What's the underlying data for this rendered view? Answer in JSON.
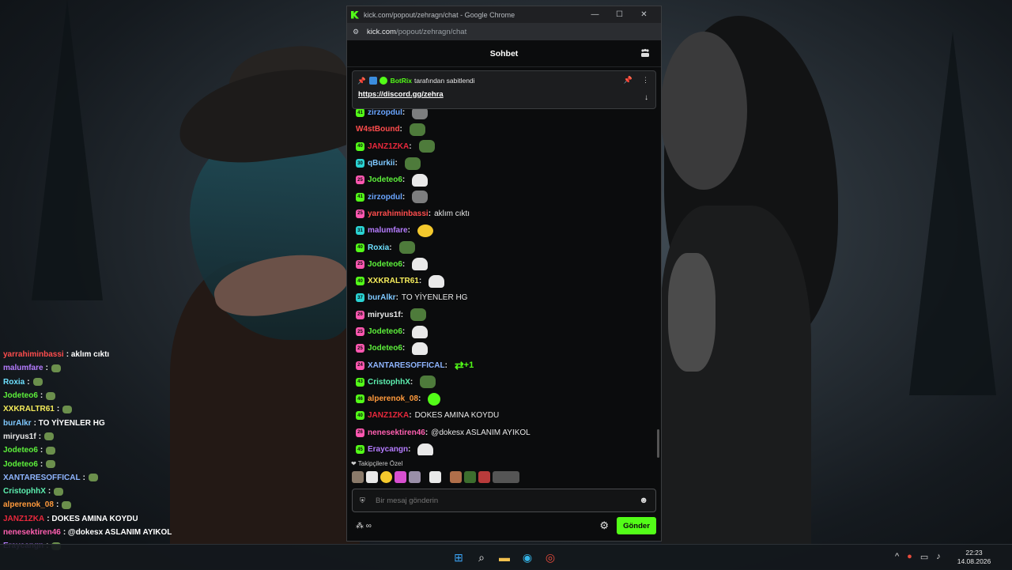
{
  "window": {
    "title": "kick.com/popout/zehragn/chat - Google Chrome",
    "url_domain": "kick.com",
    "url_path": "/popout/zehragn/chat",
    "controls": {
      "minimize": "—",
      "maximize": "☐",
      "close": "✕"
    }
  },
  "chat_header": {
    "title": "Sohbet"
  },
  "pinned": {
    "bot_name": "BotRix",
    "pinned_by": "tarafından sabitlendi",
    "link": "https://discord.gg/zehra"
  },
  "messages": [
    {
      "badge": "41",
      "badge_color": "#53fc18",
      "user": "zirzopdul",
      "user_color": "#6aa5ff",
      "text": "",
      "emote": "cat"
    },
    {
      "badge": "",
      "badge_color": "",
      "user": "W4stBound",
      "user_color": "#ff4d4d",
      "text": "",
      "emote": "frog"
    },
    {
      "badge": "40",
      "badge_color": "#53fc18",
      "user": "JANZ1ZKA",
      "user_color": "#e8283c",
      "text": "",
      "emote": "frog"
    },
    {
      "badge": "30",
      "badge_color": "#2ad3d3",
      "user": "qBurkii",
      "user_color": "#7ec8ff",
      "text": "",
      "emote": "frog"
    },
    {
      "badge": "25",
      "badge_color": "#ff57b0",
      "user": "Jodeteo6",
      "user_color": "#5df03b",
      "text": "",
      "emote": "ghost"
    },
    {
      "badge": "41",
      "badge_color": "#53fc18",
      "user": "zirzopdul",
      "user_color": "#6aa5ff",
      "text": "",
      "emote": "cat"
    },
    {
      "badge": "25",
      "badge_color": "#ff57b0",
      "user": "yarrahiminbassi",
      "user_color": "#ff4d4d",
      "text": "aklım cıktı",
      "emote": ""
    },
    {
      "badge": "31",
      "badge_color": "#2ad3d3",
      "user": "malumfare",
      "user_color": "#b57cff",
      "text": "",
      "emote": "yellow"
    },
    {
      "badge": "40",
      "badge_color": "#53fc18",
      "user": "Roxia",
      "user_color": "#6de0ff",
      "text": "",
      "emote": "frog"
    },
    {
      "badge": "25",
      "badge_color": "#ff57b0",
      "user": "Jodeteo6",
      "user_color": "#5df03b",
      "text": "",
      "emote": "ghost"
    },
    {
      "badge": "40",
      "badge_color": "#53fc18",
      "user": "XXKRALTR61",
      "user_color": "#f5ec5b",
      "text": "",
      "emote": "ghost"
    },
    {
      "badge": "37",
      "badge_color": "#2ad3d3",
      "user": "burAlkr",
      "user_color": "#7ec8ff",
      "text": "TO YİYENLER HG",
      "emote": ""
    },
    {
      "badge": "26",
      "badge_color": "#ff57b0",
      "user": "miryus1f",
      "user_color": "#e8e8e8",
      "text": "",
      "emote": "frog"
    },
    {
      "badge": "25",
      "badge_color": "#ff57b0",
      "user": "Jodeteo6",
      "user_color": "#5df03b",
      "text": "",
      "emote": "ghost"
    },
    {
      "badge": "25",
      "badge_color": "#ff57b0",
      "user": "Jodeteo6",
      "user_color": "#5df03b",
      "text": "",
      "emote": "ghost"
    },
    {
      "badge": "24",
      "badge_color": "#ff57b0",
      "user": "XANTARESOFFICAL",
      "user_color": "#8fb5ff",
      "text": "",
      "emote": "retweet",
      "emote_text": "+1"
    },
    {
      "badge": "43",
      "badge_color": "#53fc18",
      "user": "CristophhX",
      "user_color": "#5df0b0",
      "text": "",
      "emote": "frog"
    },
    {
      "badge": "46",
      "badge_color": "#53fc18",
      "user": "alperenok_08",
      "user_color": "#ff9a3c",
      "text": "",
      "emote": "green"
    },
    {
      "badge": "40",
      "badge_color": "#53fc18",
      "user": "JANZ1ZKA",
      "user_color": "#e8283c",
      "text": "DOKES AMINA KOYDU",
      "emote": ""
    },
    {
      "badge": "26",
      "badge_color": "#ff57b0",
      "user": "nenesektiren46",
      "user_color": "#ff5fb0",
      "text": "@dokesx ASLANIM AYIKOL",
      "emote": ""
    },
    {
      "badge": "45",
      "badge_color": "#53fc18",
      "user": "Eraycangn",
      "user_color": "#b57cff",
      "text": "",
      "emote": "ghost"
    }
  ],
  "followers_only": "Takipçilere Özel",
  "input": {
    "placeholder": "Bir mesaj gönderin"
  },
  "send_label": "Gönder",
  "overlay": [
    {
      "user": "yarrahiminbassi",
      "color": "#ff4d4d",
      "text": ": aklım cıktı"
    },
    {
      "user": "malumfare",
      "color": "#b57cff",
      "text": ":"
    },
    {
      "user": "Roxia",
      "color": "#6de0ff",
      "text": ":"
    },
    {
      "user": "Jodeteo6",
      "color": "#5df03b",
      "text": ":"
    },
    {
      "user": "XXKRALTR61",
      "color": "#f5ec5b",
      "text": ":"
    },
    {
      "user": "burAlkr",
      "color": "#7ec8ff",
      "text": ": TO YİYENLER HG"
    },
    {
      "user": "miryus1f",
      "color": "#e8e8e8",
      "text": ":"
    },
    {
      "user": "Jodeteo6",
      "color": "#5df03b",
      "text": ":"
    },
    {
      "user": "Jodeteo6",
      "color": "#5df03b",
      "text": ":"
    },
    {
      "user": "XANTARESOFFICAL",
      "color": "#8fb5ff",
      "text": ":"
    },
    {
      "user": "CristophhX",
      "color": "#5df0b0",
      "text": ":"
    },
    {
      "user": "alperenok_08",
      "color": "#ff9a3c",
      "text": ":"
    },
    {
      "user": "JANZ1ZKA",
      "color": "#e8283c",
      "text": ": DOKES AMINA KOYDU"
    },
    {
      "user": "nenesektiren46",
      "color": "#ff5fb0",
      "text": ": @dokesx ASLANIM AYIKOL"
    },
    {
      "user": "Eraycangn",
      "color": "#b57cff",
      "text": ":"
    }
  ],
  "taskbar": {
    "time": "22:23",
    "date": "14.08.2026"
  },
  "icons": [
    "kick-logo",
    "tune-icon",
    "people-icon",
    "pin-icon",
    "botrix-icon",
    "verified-icon",
    "more-icon",
    "arrow-down-icon",
    "heart-icon",
    "shield-icon",
    "smile-icon",
    "gear-icon",
    "windows-icon",
    "search-icon",
    "folder-icon",
    "edge-icon",
    "chrome-icon"
  ]
}
